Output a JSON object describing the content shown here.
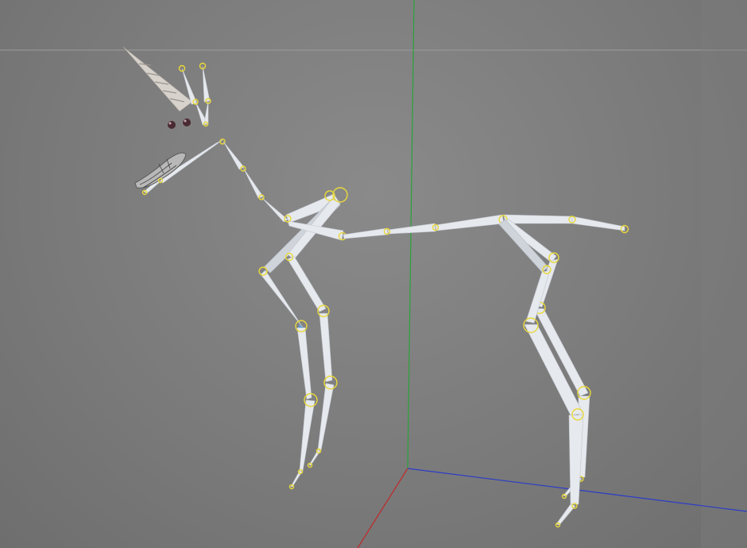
{
  "app": {
    "view": "perspective-viewport"
  },
  "colors": {
    "background": "#7b7b7b",
    "bone": "#e6e9ee",
    "joint": "#e9d93a",
    "axis_x": "#c0282a",
    "axis_y": "#2aa33a",
    "axis_z": "#2a3cc8",
    "horizon": "#9a9a9a",
    "eye": "#4a2a33",
    "horn": "#d8d2cc"
  },
  "icons": {
    "horn": "unicorn-horn-mesh",
    "eyes": "eye-spheres",
    "mouth": "mouth-mesh"
  }
}
